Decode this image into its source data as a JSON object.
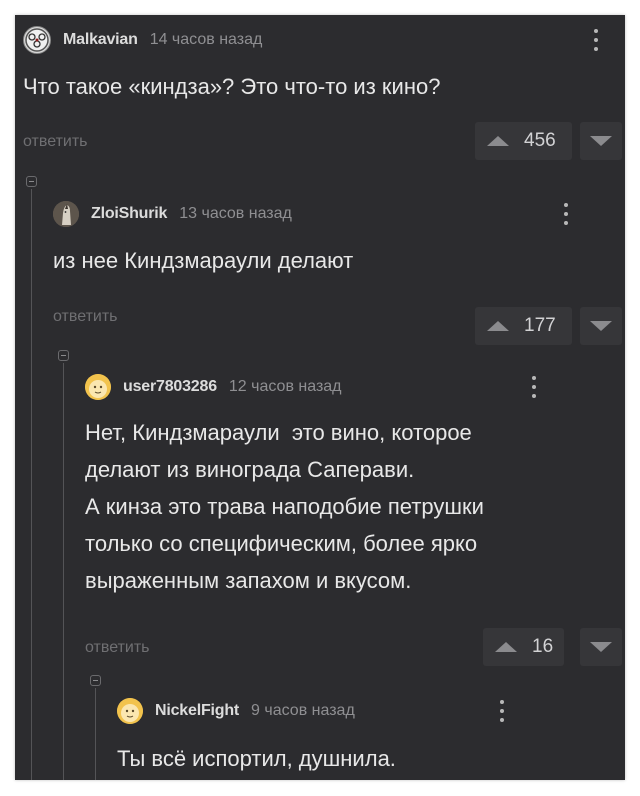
{
  "comments": [
    {
      "username": "Malkavian",
      "time": "14 часов назад",
      "text": "Что такое «киндза»? Это что-то из кино?",
      "reply_label": "ответить",
      "rating": "456",
      "avatar_icon": "malkavian-emblem-icon"
    },
    {
      "username": "ZloiShurik",
      "time": "13 часов назад",
      "text": "из нее Киндзмараули делают",
      "reply_label": "ответить",
      "rating": "177",
      "avatar_icon": "horse-avatar-icon"
    },
    {
      "username": "user7803286",
      "time": "12 часов назад",
      "text": "Нет, Киндзмараули  это вино, которое\nделают из винограда Саперави.\nА кинза это трава наподобие петрушки\nтолько со специфическим, более ярко\nвыраженным запахом и вкусом.",
      "reply_label": "ответить",
      "rating": "16",
      "avatar_icon": "default-avatar-icon"
    },
    {
      "username": "NickelFight",
      "time": "9 часов назад",
      "text": "Ты всё испортил, душнила.",
      "avatar_icon": "default-avatar-icon"
    }
  ],
  "colors": {
    "background": "#2c2c2f",
    "text": "#e8e8e8",
    "muted": "#8f8f92",
    "vote_bg": "#363639"
  }
}
